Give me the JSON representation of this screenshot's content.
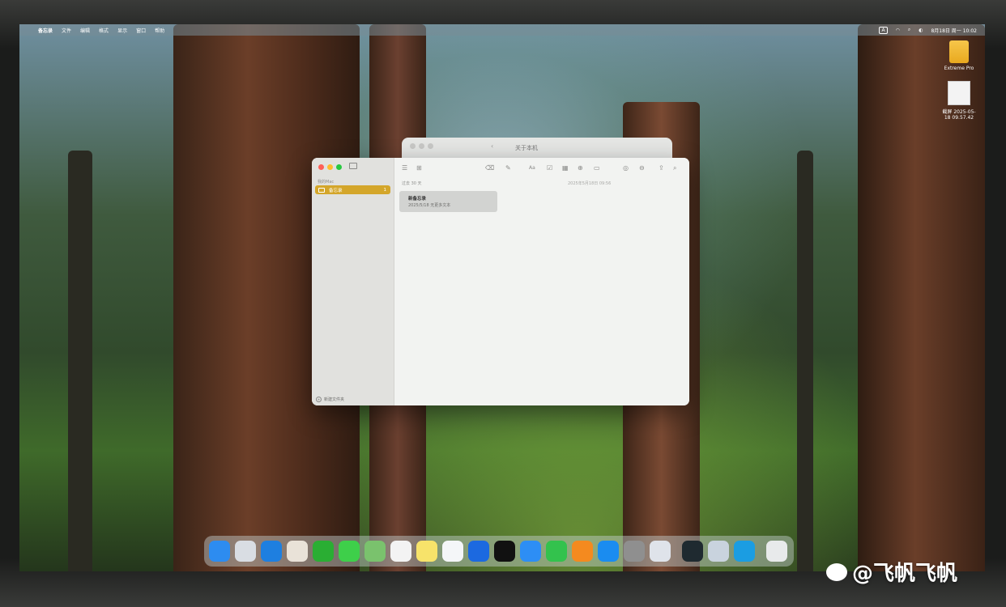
{
  "menubar": {
    "app_name": "备忘录",
    "items": [
      "文件",
      "编辑",
      "格式",
      "显示",
      "窗口",
      "帮助"
    ],
    "status_input": "A",
    "datetime": "8月18日 周一 10:02"
  },
  "desktop": {
    "items": [
      {
        "label": "Extreme Pro",
        "icon": "drive-icon"
      },
      {
        "label": "截屏 2025-05-18 09.57.42",
        "icon": "screenshot-file-icon"
      }
    ]
  },
  "about_window": {
    "title": "关于本机"
  },
  "notes_window": {
    "sidebar": {
      "section": "我的Mac",
      "folders": [
        {
          "name": "备忘录",
          "count": "1"
        }
      ],
      "new_folder": "新建文件夹"
    },
    "list_header": "过去 30 天",
    "timestamp": "2025年5月18日 09:56",
    "notes": [
      {
        "title": "新备忘录",
        "preview": "2025/5/18  无更多文本"
      }
    ],
    "toolbar": {
      "text_format_label": "Aa"
    }
  },
  "dock": {
    "apps": [
      {
        "name": "Finder",
        "icon": "finder-icon",
        "color": "#2d8cf0"
      },
      {
        "name": "Launchpad",
        "icon": "launchpad-icon",
        "color": "#d9dde3"
      },
      {
        "name": "Safari",
        "icon": "safari-icon",
        "color": "#1e7fe0"
      },
      {
        "name": "Memoji",
        "icon": "memoji-icon",
        "color": "#e9e2d8"
      },
      {
        "name": "WeChat",
        "icon": "wechat-icon",
        "color": "#2aae33"
      },
      {
        "name": "Messages",
        "icon": "messages-icon",
        "color": "#3ecf4a"
      },
      {
        "name": "Maps",
        "icon": "maps-icon",
        "color": "#7ac26d"
      },
      {
        "name": "Photos",
        "icon": "photos-icon",
        "color": "#f3f3f3"
      },
      {
        "name": "Notes",
        "icon": "notes-icon",
        "color": "#f7e36a"
      },
      {
        "name": "Freeform",
        "icon": "freeform-icon",
        "color": "#f4f6f8"
      },
      {
        "name": "Shazam",
        "icon": "shazam-icon",
        "color": "#1c69e0"
      },
      {
        "name": "TV",
        "icon": "tv-icon",
        "color": "#111111"
      },
      {
        "name": "Keynote",
        "icon": "keynote-icon",
        "color": "#2d8ef5"
      },
      {
        "name": "Numbers",
        "icon": "numbers-icon",
        "color": "#33c24d"
      },
      {
        "name": "Pages",
        "icon": "pages-icon",
        "color": "#f48a1f"
      },
      {
        "name": "App Store",
        "icon": "appstore-icon",
        "color": "#1a8cf0"
      },
      {
        "name": "System Settings",
        "icon": "settings-icon",
        "color": "#8f8f8f"
      },
      {
        "name": "iPhone Mirroring",
        "icon": "iphone-mirroring-icon",
        "color": "#dfe3ea"
      },
      {
        "name": "Activity",
        "icon": "activity-icon",
        "color": "#1f2a30"
      },
      {
        "name": "Preview",
        "icon": "preview-icon",
        "color": "#c9d3de"
      },
      {
        "name": "Edge",
        "icon": "edge-icon",
        "color": "#1b9de2"
      },
      {
        "name": "Trash",
        "icon": "trash-icon",
        "color": "#e8eaeb"
      }
    ]
  },
  "watermark": {
    "text": "@飞帆飞帆"
  }
}
